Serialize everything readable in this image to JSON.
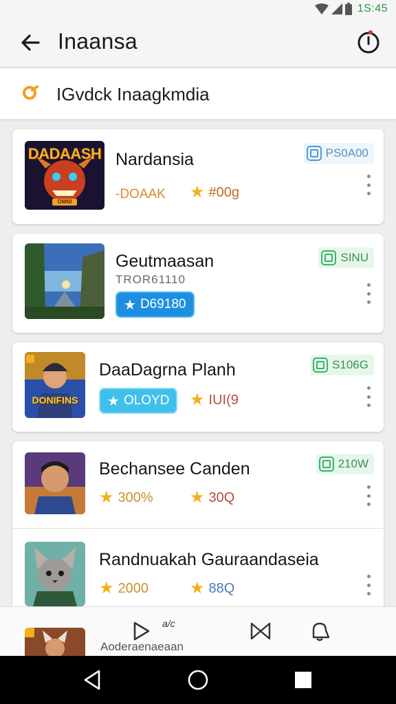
{
  "status": {
    "time": "1S:45"
  },
  "appbar": {
    "title": "Inaansa"
  },
  "search": {
    "text": "IGvdck Inaagkmdia"
  },
  "games": [
    {
      "title": "Nardansia",
      "meta": "-DOAAK",
      "rating": "#00g",
      "tag": "PS0A00",
      "thumb_text": "DADAASH",
      "thumb_sub": "OMNI"
    },
    {
      "title": "Geutmaasan",
      "subtitle": "TROR61110",
      "pill": "D69180",
      "tag": "SINU"
    },
    {
      "title": "DaaDagrna Planh",
      "pill": "OLOYD",
      "rating": "IUI(9",
      "tag": "S106G",
      "thumb_text": "DONIFINS"
    },
    {
      "title": "Bechansee Canden",
      "meta_rating": "300%",
      "rating": "30Q",
      "tag": "210W"
    },
    {
      "title": "Randnuakah Gauraandaseia",
      "meta_rating": "2000",
      "rating": "88Q"
    }
  ],
  "bottombar": {
    "label": "Aoderaenaeaan",
    "badge": "a/c"
  },
  "colors": {
    "accent_blue": "#1d8fe0",
    "accent_green": "#3cb26a",
    "star": "#f2b01e",
    "status_time": "#2f8f4e"
  },
  "icons": [
    "back-arrow-icon",
    "timer-icon",
    "search-icon",
    "kebab-icon",
    "star-icon",
    "play-icon",
    "bowtie-icon",
    "bell-icon",
    "nav-back-icon",
    "nav-home-icon",
    "nav-recents-icon"
  ]
}
